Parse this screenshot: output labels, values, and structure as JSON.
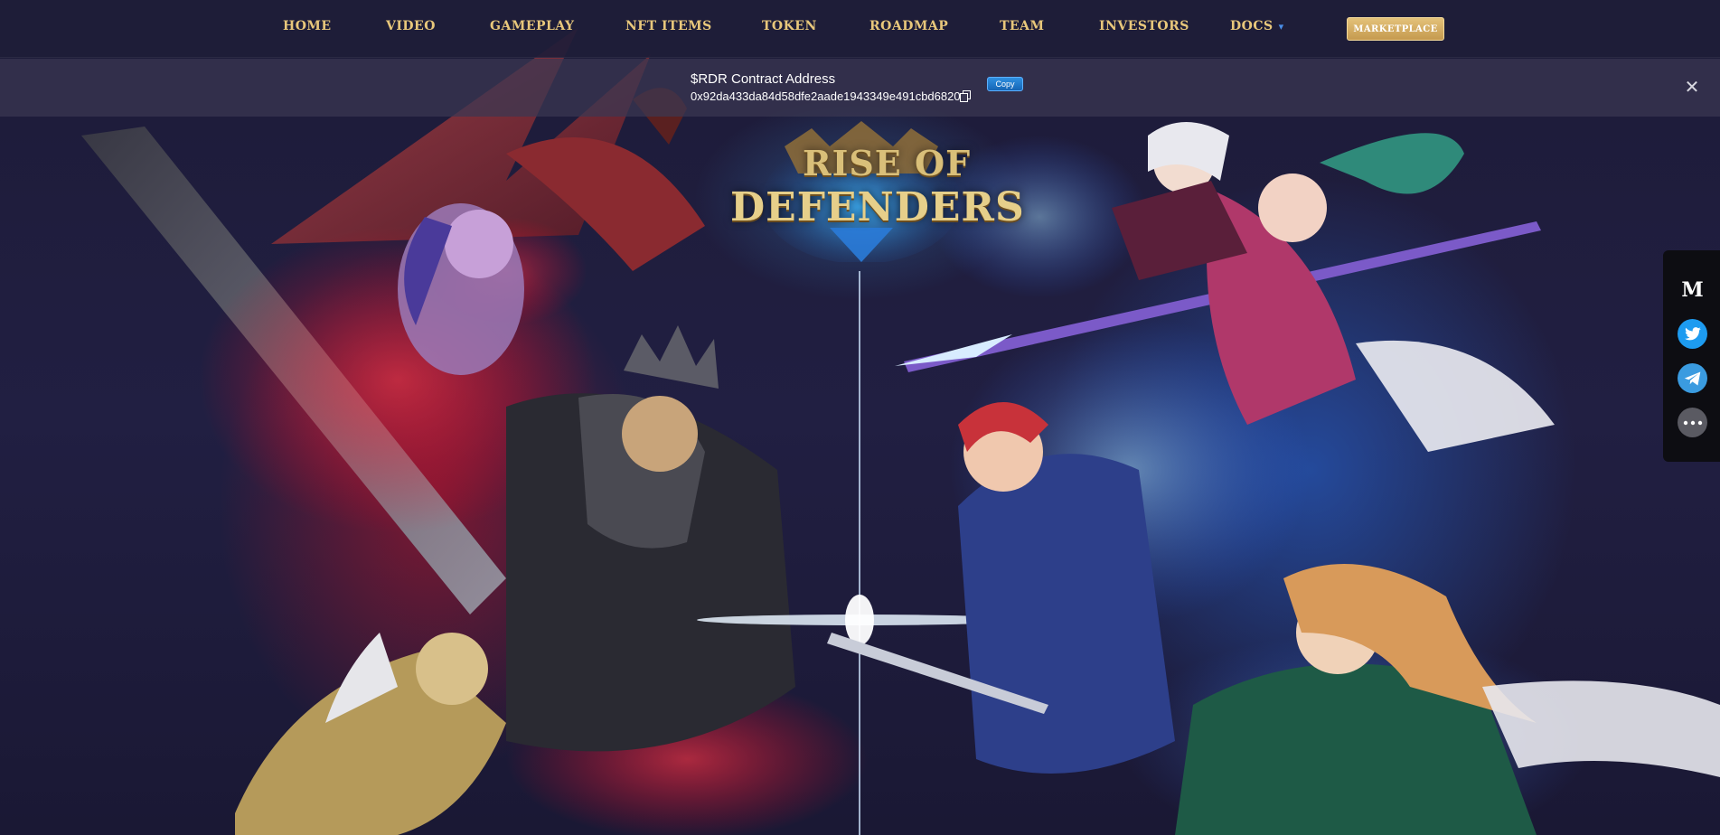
{
  "nav": {
    "items": [
      {
        "label": "HOME"
      },
      {
        "label": "VIDEO"
      },
      {
        "label": "GAMEPLAY"
      },
      {
        "label": "NFT ITEMS"
      },
      {
        "label": "TOKEN"
      },
      {
        "label": "ROADMAP"
      },
      {
        "label": "TEAM"
      },
      {
        "label": "INVESTORS"
      },
      {
        "label": "DOCS"
      }
    ],
    "marketplace_label": "MARKETPLACE"
  },
  "contract": {
    "title": "$RDR Contract Address",
    "address": "0x92da433da84d58dfe2aade1943349e491cbd6820",
    "copy_label": "Copy",
    "close_symbol": "✕"
  },
  "logo": {
    "line1": "RISE OF",
    "line2": "DEFENDERS"
  },
  "social": {
    "medium_glyph": "M",
    "icons": [
      "medium-icon",
      "twitter-icon",
      "telegram-icon",
      "more-icon"
    ]
  },
  "colors": {
    "nav_text": "#e8c77b",
    "marketplace_bg": "#d6b067",
    "copy_button": "#1e7bd0",
    "twitter_blue": "#1d9bf0",
    "telegram_blue": "#3a9be0"
  }
}
